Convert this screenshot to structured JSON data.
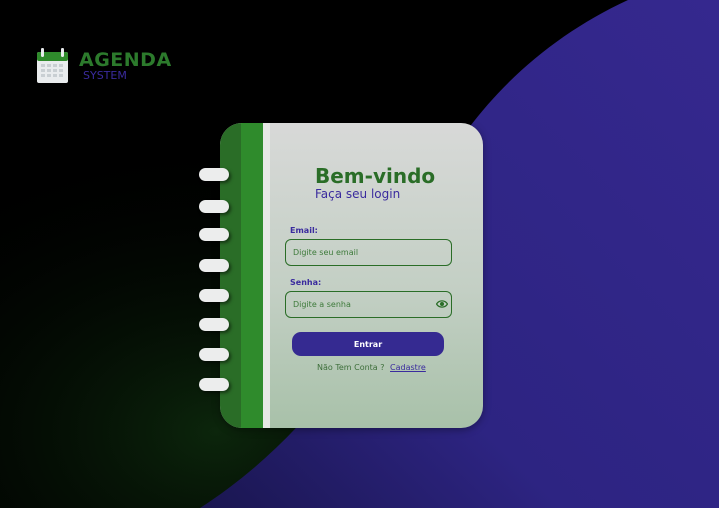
{
  "brand": {
    "title": "AGENDA",
    "subtitle": "SYSTEM",
    "icon": "calendar-icon"
  },
  "login": {
    "heading": "Bem-vindo",
    "subheading": "Faça seu login",
    "email_label": "Email:",
    "email_placeholder": "Digite seu email",
    "password_label": "Senha:",
    "password_placeholder": "Digite a senha",
    "show_password_icon": "eye-icon",
    "submit_label": "Entrar",
    "no_account_text": "Não Tem Conta ?",
    "signup_link": "Cadastre"
  },
  "colors": {
    "background": "#000000",
    "accent_blue": "#352a91",
    "brand_green": "#2a6d27",
    "spine_green": "#2f8b2c"
  }
}
